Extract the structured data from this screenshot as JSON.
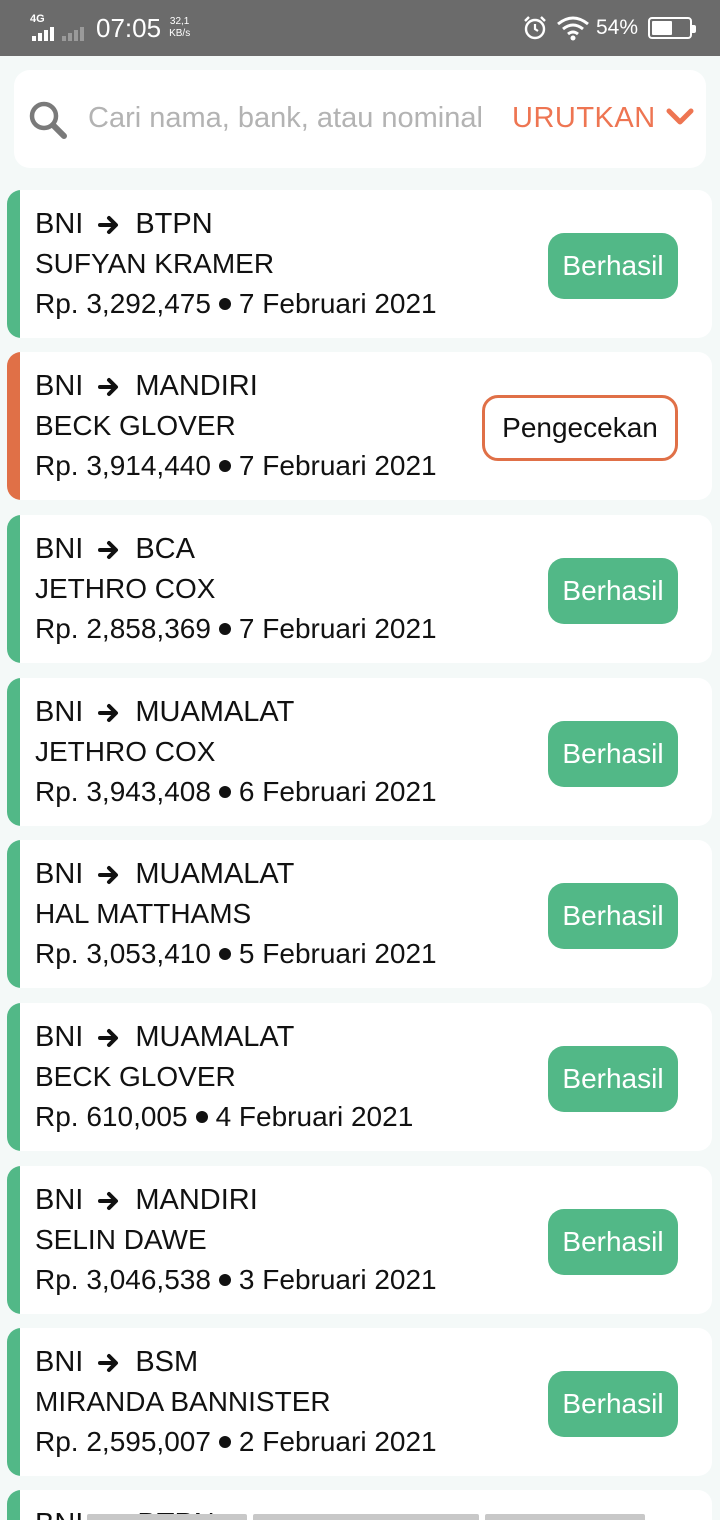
{
  "status_bar": {
    "network": "4G",
    "time": "07:05",
    "speed_value": "32,1",
    "speed_unit": "KB/s",
    "battery_percent": "54%"
  },
  "search": {
    "placeholder": "Cari nama, bank, atau nominal",
    "sort_label": "URUTKAN"
  },
  "colors": {
    "success": "#52b887",
    "checking": "#e07047",
    "accent": "#ee7552"
  },
  "transactions": [
    {
      "from": "BNI",
      "to": "BTPN",
      "name": "SUFYAN KRAMER",
      "amount": "Rp. 3,292,475",
      "date": "7 Februari 2021",
      "status": "Berhasil"
    },
    {
      "from": "BNI",
      "to": "MANDIRI",
      "name": "BECK GLOVER",
      "amount": "Rp. 3,914,440",
      "date": "7 Februari 2021",
      "status": "Pengecekan"
    },
    {
      "from": "BNI",
      "to": "BCA",
      "name": "JETHRO COX",
      "amount": "Rp. 2,858,369",
      "date": "7 Februari 2021",
      "status": "Berhasil"
    },
    {
      "from": "BNI",
      "to": "MUAMALAT",
      "name": "JETHRO COX",
      "amount": "Rp. 3,943,408",
      "date": "6 Februari 2021",
      "status": "Berhasil"
    },
    {
      "from": "BNI",
      "to": "MUAMALAT",
      "name": "HAL MATTHAMS",
      "amount": "Rp. 3,053,410",
      "date": "5 Februari 2021",
      "status": "Berhasil"
    },
    {
      "from": "BNI",
      "to": "MUAMALAT",
      "name": "BECK GLOVER",
      "amount": "Rp. 610,005",
      "date": "4 Februari 2021",
      "status": "Berhasil"
    },
    {
      "from": "BNI",
      "to": "MANDIRI",
      "name": "SELIN DAWE",
      "amount": "Rp. 3,046,538",
      "date": "3 Februari 2021",
      "status": "Berhasil"
    },
    {
      "from": "BNI",
      "to": "BSM",
      "name": "MIRANDA BANNISTER",
      "amount": "Rp. 2,595,007",
      "date": "2 Februari 2021",
      "status": "Berhasil"
    }
  ],
  "partial_item": {
    "from": "BNI",
    "to": "BTPN"
  }
}
